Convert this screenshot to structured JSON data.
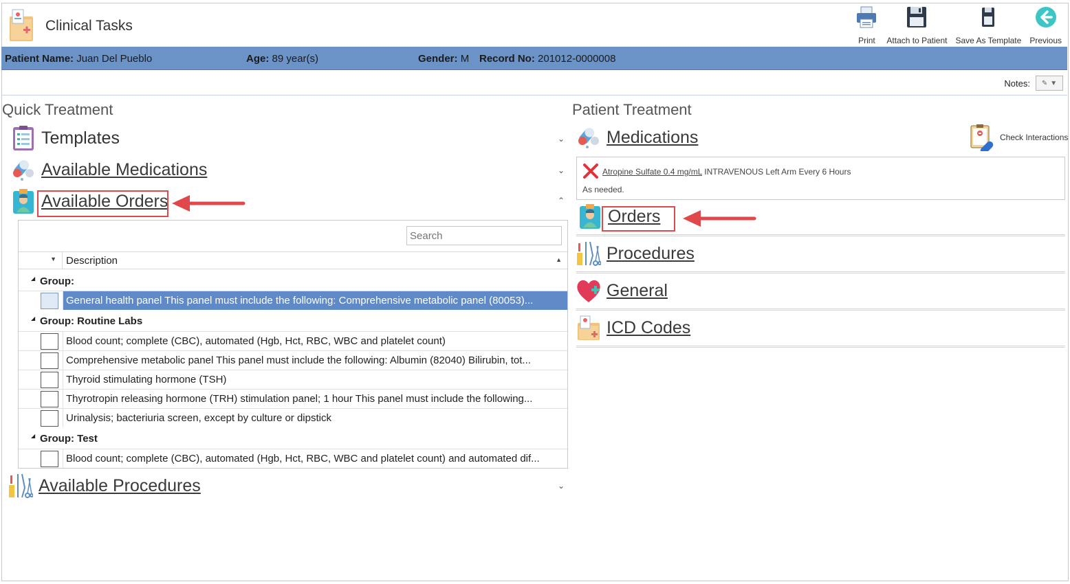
{
  "app": {
    "title": "Clinical Tasks"
  },
  "toolbar": {
    "print": "Print",
    "attach": "Attach to Patient",
    "save_template": "Save As Template",
    "previous": "Previous"
  },
  "patient": {
    "name_label": "Patient Name:",
    "name": "Juan Del Pueblo",
    "age_label": "Age:",
    "age": "89 year(s)",
    "gender_label": "Gender:",
    "gender": "M",
    "record_label": "Record No:",
    "record": "201012-0000008"
  },
  "notes": {
    "label": "Notes:"
  },
  "quick": {
    "title": "Quick Treatment",
    "templates": "Templates",
    "available_medications": "Available Medications",
    "available_orders": "Available Orders",
    "available_procedures": "Available Procedures"
  },
  "orders_grid": {
    "search_placeholder": "Search",
    "column_description": "Description",
    "groups": [
      {
        "label": "Group:",
        "rows": [
          {
            "text": "General health panel This panel must include the following: Comprehensive metabolic panel (80053)...",
            "selected": true
          }
        ]
      },
      {
        "label": "Group: Routine Labs",
        "rows": [
          {
            "text": "Blood count; complete (CBC), automated (Hgb, Hct, RBC, WBC and platelet count)"
          },
          {
            "text": "Comprehensive metabolic panel This panel must include the following: Albumin (82040) Bilirubin, tot..."
          },
          {
            "text": "Thyroid stimulating hormone (TSH)"
          },
          {
            "text": "Thyrotropin releasing hormone (TRH) stimulation panel; 1 hour This panel must include the following..."
          },
          {
            "text": "Urinalysis; bacteriuria screen, except by culture or dipstick"
          }
        ]
      },
      {
        "label": "Group: Test",
        "rows": [
          {
            "text": "Blood count; complete (CBC), automated (Hgb, Hct, RBC, WBC and platelet count) and automated dif..."
          }
        ]
      }
    ]
  },
  "patient_treatment": {
    "title": "Patient Treatment",
    "medications": "Medications",
    "check_interactions": "Check Interactions",
    "medication_entry": {
      "name": "Atropine Sulfate  0.4 mg/mL",
      "details": " INTRAVENOUS Left Arm Every 6 Hours",
      "note": "As needed."
    },
    "orders": "Orders",
    "procedures": "Procedures",
    "general": "General",
    "icd_codes": "ICD Codes"
  },
  "colors": {
    "patient_bar": "#6b93c8",
    "selected_row": "#5f8ac7",
    "highlight": "#e0484c"
  }
}
